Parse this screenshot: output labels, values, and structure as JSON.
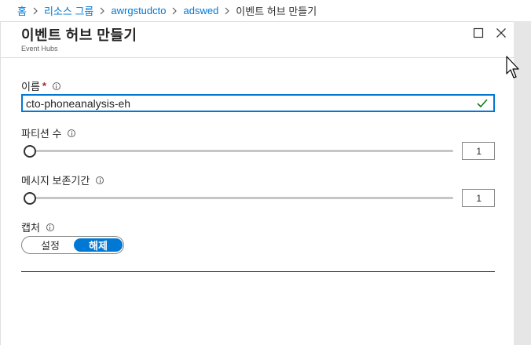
{
  "breadcrumb": {
    "items": [
      "홈",
      "리소스 그룹",
      "awrgstudcto",
      "adswed"
    ],
    "current": "이벤트 허브 만들기"
  },
  "blade": {
    "title": "이벤트 허브 만들기",
    "subtitle": "Event Hubs"
  },
  "form": {
    "name_label": "이름",
    "name_required_mark": "*",
    "name_value": "cto-phoneanalysis-eh",
    "partition_label": "파티션 수",
    "partition_value": "1",
    "retention_label": "메시지 보존기간",
    "retention_value": "1",
    "capture_label": "캡처",
    "capture_on_label": "설정",
    "capture_off_label": "해제",
    "capture_selected": "해제"
  },
  "colors": {
    "accent": "#0078d4",
    "valid_check": "#107c10",
    "required": "#a4262c"
  },
  "icons": [
    "chevron-right-icon",
    "maximize-icon",
    "close-icon",
    "info-icon",
    "checkmark-icon",
    "mouse-pointer-icon"
  ]
}
